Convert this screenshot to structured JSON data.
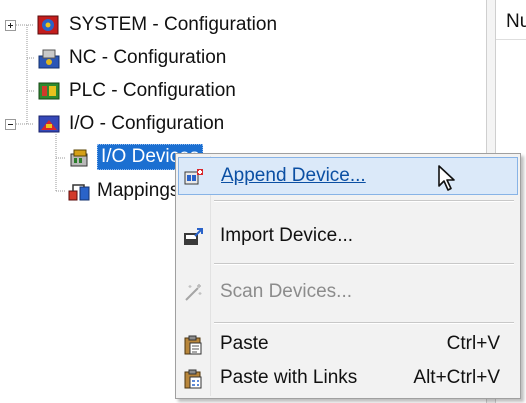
{
  "tree": {
    "nodes": [
      {
        "label": "SYSTEM - Configuration",
        "icon": "system-config-icon"
      },
      {
        "label": "NC - Configuration",
        "icon": "nc-config-icon"
      },
      {
        "label": "PLC - Configuration",
        "icon": "plc-config-icon"
      },
      {
        "label": "I/O - Configuration",
        "icon": "io-config-icon"
      },
      {
        "label": "I/O Devices",
        "icon": "io-devices-icon",
        "selected": true
      },
      {
        "label": "Mappings",
        "icon": "mappings-icon"
      }
    ]
  },
  "right_pane": {
    "header": "Nu"
  },
  "context_menu": {
    "items": [
      {
        "label": "Append Device...",
        "icon": "append-device-icon",
        "highlighted": true
      },
      {
        "label": "Import Device...",
        "icon": "import-device-icon"
      },
      {
        "label": "Scan Devices...",
        "icon": "scan-devices-icon",
        "disabled": true
      },
      {
        "label": "Paste",
        "shortcut": "Ctrl+V",
        "icon": "paste-icon"
      },
      {
        "label": "Paste with Links",
        "shortcut": "Alt+Ctrl+V",
        "icon": "paste-links-icon"
      }
    ]
  },
  "colors": {
    "selection": "#1b6fd1",
    "menu_highlight": "#dbe9f9",
    "menu_highlight_border": "#87b3e6",
    "menu_background": "#f2f2f2"
  }
}
